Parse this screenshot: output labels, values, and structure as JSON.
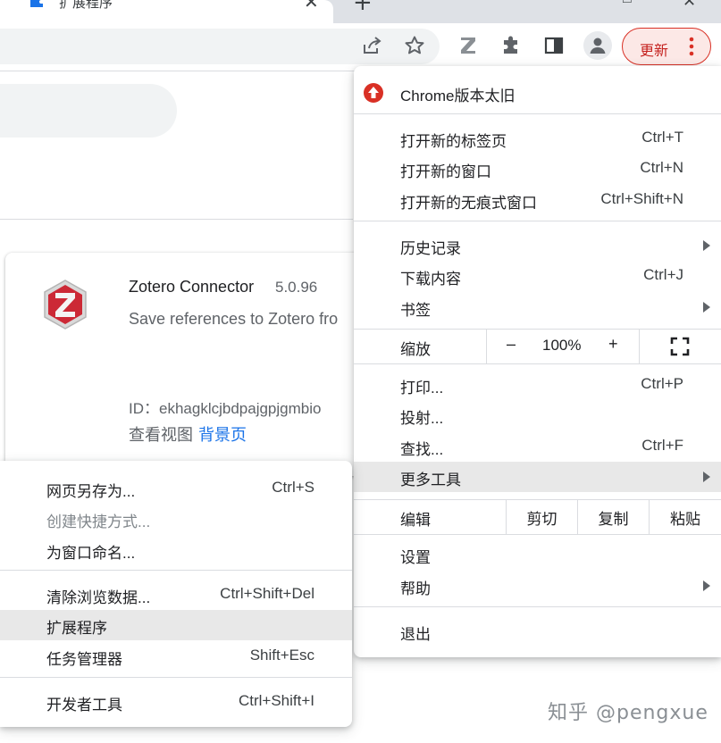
{
  "tab": {
    "title": "扩展程序",
    "close_glyph": "✕",
    "new_tab_glyph": "+"
  },
  "window": {
    "minimize_glyph": "□",
    "close_glyph": "✕"
  },
  "toolbar": {
    "icons": [
      "share-icon",
      "star-icon",
      "zotero-icon",
      "extensions-icon",
      "side-panel-icon",
      "profile-icon"
    ],
    "update_label": "更新",
    "update_color": "#d93025"
  },
  "extension": {
    "name": "Zotero Connector",
    "version": "5.0.96",
    "description": "Save references to Zotero fro",
    "id_line": "ID：ekhagklcjbdpajgpjgmbio",
    "views_label": "查看视图",
    "views_link": "背景页"
  },
  "main_menu": {
    "warning": "Chrome版本太旧",
    "items": [
      {
        "label": "打开新的标签页",
        "shortcut": "Ctrl+T"
      },
      {
        "label": "打开新的窗口",
        "shortcut": "Ctrl+N"
      },
      {
        "label": "打开新的无痕式窗口",
        "shortcut": "Ctrl+Shift+N"
      },
      {
        "label": "历史记录",
        "shortcut": ""
      },
      {
        "label": "下载内容",
        "shortcut": "Ctrl+J"
      },
      {
        "label": "书签",
        "shortcut": ""
      },
      {
        "label": "打印...",
        "shortcut": "Ctrl+P"
      },
      {
        "label": "投射...",
        "shortcut": ""
      },
      {
        "label": "查找...",
        "shortcut": "Ctrl+F"
      },
      {
        "label": "更多工具",
        "shortcut": ""
      },
      {
        "label": "设置",
        "shortcut": ""
      },
      {
        "label": "帮助",
        "shortcut": ""
      },
      {
        "label": "退出",
        "shortcut": ""
      }
    ],
    "zoom": {
      "label": "缩放",
      "minus": "–",
      "value": "100%",
      "plus": "+"
    },
    "edit": {
      "label": "编辑",
      "cut": "剪切",
      "copy": "复制",
      "paste": "粘贴"
    }
  },
  "more_tools_menu": {
    "items": [
      {
        "label": "网页另存为...",
        "shortcut": "Ctrl+S"
      },
      {
        "label": "创建快捷方式...",
        "shortcut": ""
      },
      {
        "label": "为窗口命名...",
        "shortcut": ""
      },
      {
        "label": "清除浏览数据...",
        "shortcut": "Ctrl+Shift+Del"
      },
      {
        "label": "扩展程序",
        "shortcut": ""
      },
      {
        "label": "任务管理器",
        "shortcut": "Shift+Esc"
      },
      {
        "label": "开发者工具",
        "shortcut": "Ctrl+Shift+I"
      }
    ]
  },
  "watermark": "知乎 @pengxue"
}
